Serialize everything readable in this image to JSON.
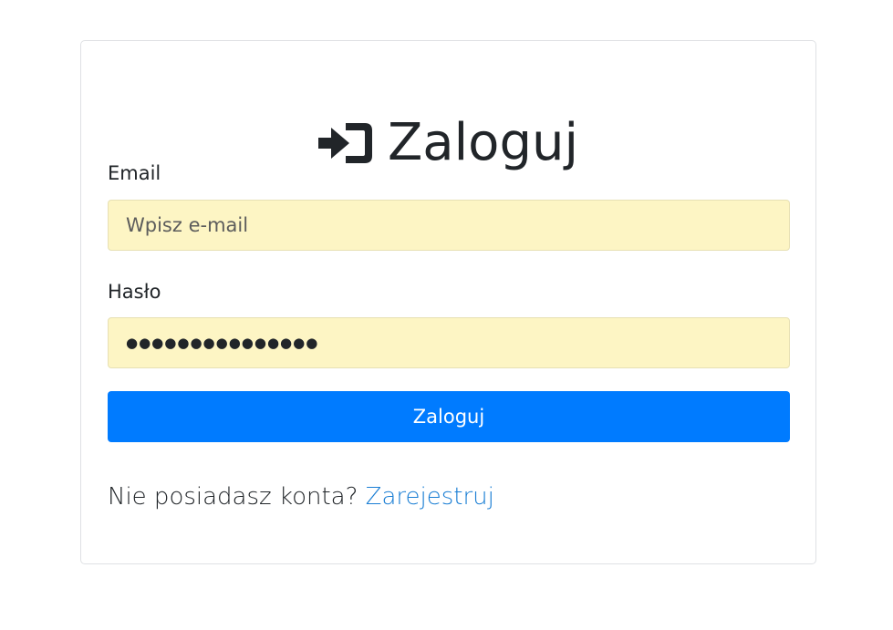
{
  "login": {
    "title": "Zaloguj",
    "email": {
      "label": "Email",
      "placeholder": "Wpisz e-mail",
      "value": ""
    },
    "password": {
      "label": "Hasło",
      "masked_value": "●●●●●●●●●●●●●●●"
    },
    "submit_label": "Zaloguj",
    "register_prompt": "Nie posiadasz konta?",
    "register_link": "Zarejestruj"
  },
  "colors": {
    "primary": "#007bff",
    "autofill_background": "#fdf5c4",
    "link": "#1a7ed4",
    "text": "#212529"
  },
  "icons": {
    "heading": "sign-in-icon"
  }
}
